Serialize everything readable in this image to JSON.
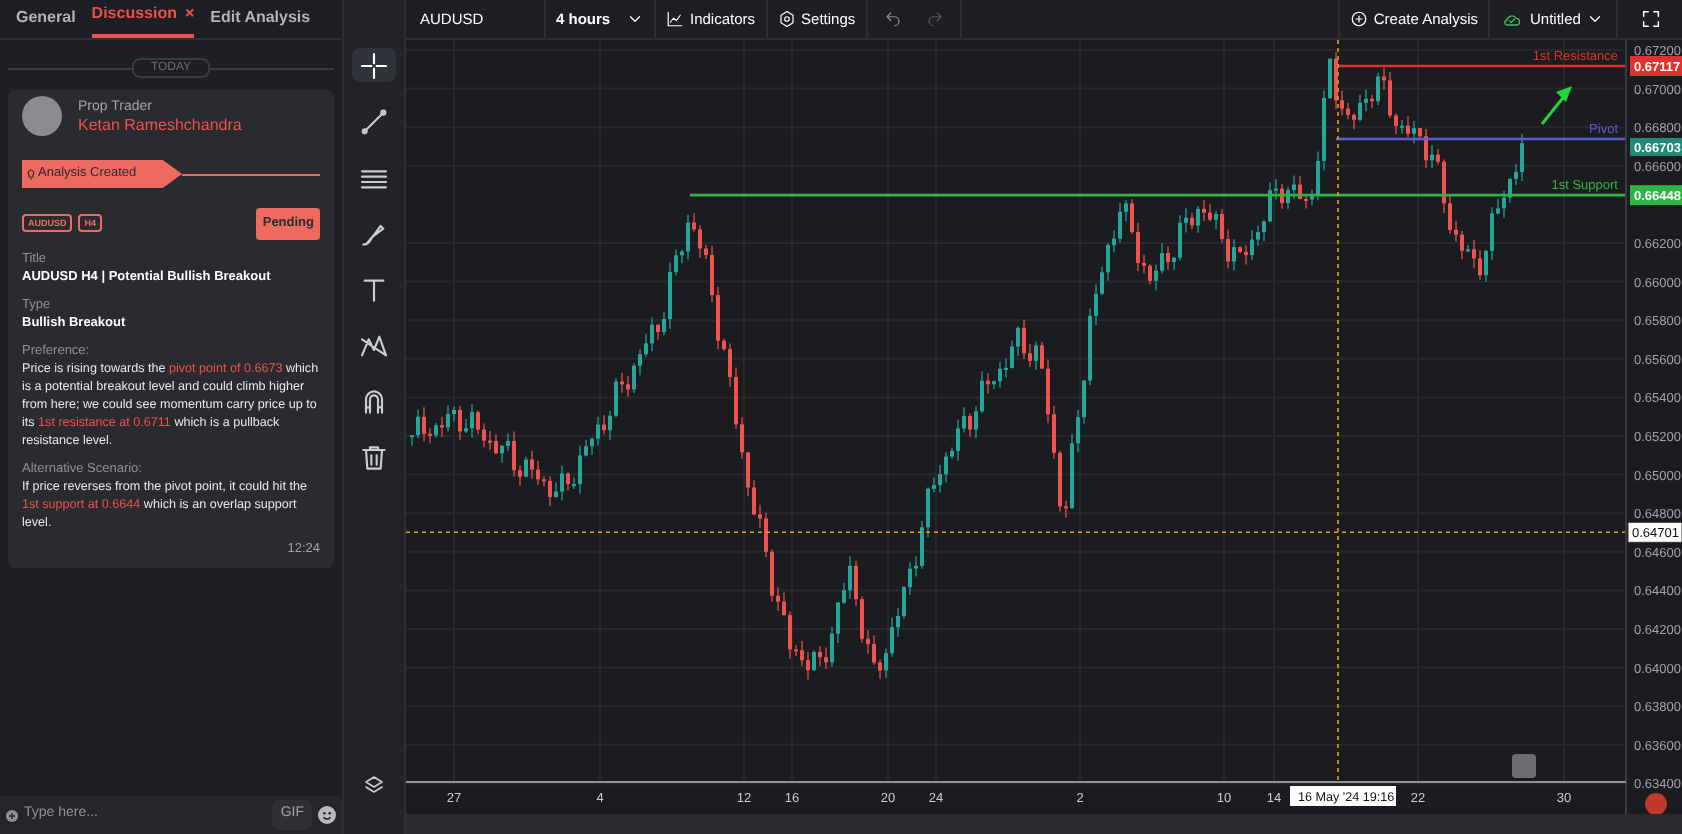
{
  "tabs": [
    {
      "label": "General",
      "selected": false
    },
    {
      "label": "Discussion",
      "selected": true,
      "close": "×"
    },
    {
      "label": "Edit Analysis",
      "selected": false
    }
  ],
  "day_divider": "TODAY",
  "message": {
    "role": "Prop Trader",
    "author": "Ketan Rameshchandra",
    "event": "Analysis Created",
    "tags": [
      "AUDUSD",
      "H4"
    ],
    "status": "Pending",
    "fields": [
      {
        "label": "Title",
        "value": "AUDUSD H4 | Potential Bullish Breakout",
        "kind": "strong"
      },
      {
        "label": "Type",
        "value": "Bullish Breakout",
        "kind": "strong"
      },
      {
        "label": "Preference:",
        "value": "Price is rising towards the **pivot point of 0.6673** which is a potential breakout level and could climb higher from here; we could see momentum carry price up to its **1st resistance at 0.6711** which is a pullback resistance level.",
        "kind": "rich"
      },
      {
        "label": "Alternative Scenario:",
        "value": "If price reverses from the pivot point, it could hit the **1st support at 0.6644** which is an overlap support level.",
        "kind": "rich"
      }
    ],
    "time": "12:24"
  },
  "composer": {
    "placeholder": "Type here...",
    "gif": "GIF"
  },
  "tools": [
    {
      "kind": "crosshair",
      "selected": true
    },
    {
      "kind": "line",
      "selected": false
    },
    {
      "kind": "lines",
      "selected": false
    },
    {
      "kind": "brush",
      "selected": false
    },
    {
      "kind": "text",
      "selected": false
    },
    {
      "kind": "pattern",
      "selected": false
    },
    {
      "kind": "magnet",
      "selected": false
    },
    {
      "kind": "trash",
      "selected": false
    }
  ],
  "toolbar": {
    "symbol": "AUDUSD",
    "timeframe": "4 hours",
    "indicators": "Indicators",
    "settings": "Settings",
    "create": "Create Analysis",
    "layout": "Untitled"
  },
  "chart": {
    "yticks": [
      "0.67200",
      "0.67000",
      "0.66800",
      "0.66600",
      "0.66200",
      "0.66000",
      "0.65800",
      "0.65600",
      "0.65400",
      "0.65200",
      "0.65000",
      "0.64800",
      "0.64600",
      "0.64400",
      "0.64200",
      "0.64000",
      "0.63800",
      "0.63600",
      "0.63400"
    ],
    "xticks": [
      "27",
      "4",
      "12",
      "16",
      "20",
      "24",
      "2",
      "10",
      "14",
      "22",
      "30"
    ],
    "levels": [
      {
        "label": "1st Resistance",
        "price": "0.67117",
        "color": "#e0312f"
      },
      {
        "label": "Pivot",
        "color": "#5b5bd6"
      },
      {
        "label": "1st Support",
        "price": "0.66448",
        "color": "#2fb345"
      }
    ],
    "current_price": "0.66703",
    "crosshair": {
      "price": "0.64701",
      "time": "16 May '24 19:16"
    }
  }
}
